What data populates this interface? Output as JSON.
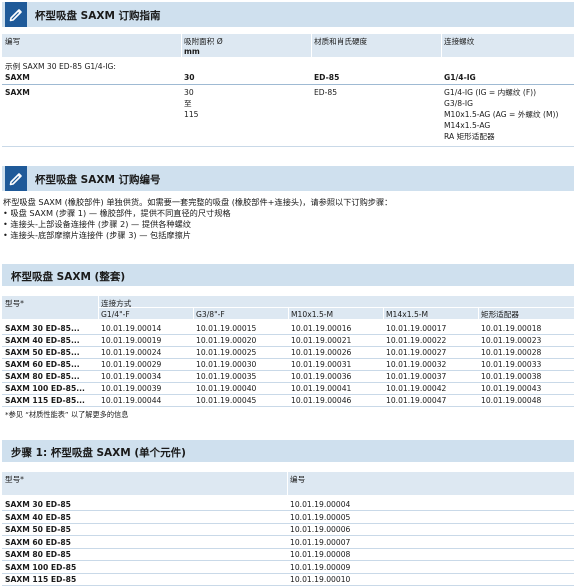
{
  "section1": {
    "title": "杯型吸盘 SAXM 订购指南",
    "headers": [
      "编写",
      "吸附面积 Ø\nmm",
      "材质和肖氏硬度",
      "连接螺纹"
    ],
    "header_col2_line1": "吸附面积 Ø",
    "header_col2_line2": "mm",
    "example_label": "示例 SAXM 30 ED-85 G1/4-IG:",
    "example_row": [
      "SAXM",
      "30",
      "ED-85",
      "G1/4-IG"
    ],
    "options_row": {
      "name": "SAXM",
      "sizes": [
        "30",
        "至",
        "115"
      ],
      "material": "ED-85",
      "threads": [
        "G1/4-IG (IG = 内螺纹 (F))",
        "G3/8-IG",
        "M10x1.5-AG (AG = 外螺纹 (M))",
        "M14x1.5-AG",
        "RA    矩形适配器"
      ]
    }
  },
  "section2": {
    "title": "杯型吸盘 SAXM 订购编号",
    "intro": "杯型吸盘 SAXM (橡胶部件) 单独供货。如需要一套完整的吸盘 (橡胶部件+连接头)，请参照以下订购步骤：",
    "bullets": [
      "• 吸盘 SAXM (步骤 1) — 橡胶部件，提供不同直径的尺寸规格",
      "• 连接头-上部设备连接件 (步骤 2) — 提供各种螺纹",
      "• 连接头-底部摩擦片连接件 (步骤 3) — 包括摩擦片"
    ]
  },
  "section3": {
    "title": "杯型吸盘 SAXM (整套)",
    "type_header": "型号*",
    "conn_header": "连接方式",
    "columns": [
      "G1/4\"-F",
      "G3/8\"-F",
      "M10x1.5-M",
      "M14x1.5-M",
      "矩形适配器"
    ],
    "rows": [
      {
        "type": "SAXM 30 ED-85...",
        "values": [
          "10.01.19.00014",
          "10.01.19.00015",
          "10.01.19.00016",
          "10.01.19.00017",
          "10.01.19.00018"
        ]
      },
      {
        "type": "SAXM 40 ED-85...",
        "values": [
          "10.01.19.00019",
          "10.01.19.00020",
          "10.01.19.00021",
          "10.01.19.00022",
          "10.01.19.00023"
        ]
      },
      {
        "type": "SAXM 50 ED-85...",
        "values": [
          "10.01.19.00024",
          "10.01.19.00025",
          "10.01.19.00026",
          "10.01.19.00027",
          "10.01.19.00028"
        ]
      },
      {
        "type": "SAXM 60 ED-85...",
        "values": [
          "10.01.19.00029",
          "10.01.19.00030",
          "10.01.19.00031",
          "10.01.19.00032",
          "10.01.19.00033"
        ]
      },
      {
        "type": "SAXM 80 ED-85...",
        "values": [
          "10.01.19.00034",
          "10.01.19.00035",
          "10.01.19.00036",
          "10.01.19.00037",
          "10.01.19.00038"
        ]
      },
      {
        "type": "SAXM 100 ED-85...",
        "values": [
          "10.01.19.00039",
          "10.01.19.00040",
          "10.01.19.00041",
          "10.01.19.00042",
          "10.01.19.00043"
        ]
      },
      {
        "type": "SAXM 115 ED-85...",
        "values": [
          "10.01.19.00044",
          "10.01.19.00045",
          "10.01.19.00046",
          "10.01.19.00047",
          "10.01.19.00048"
        ]
      }
    ],
    "footnote": "*参见 “材质性能表” 以了解更多的信息"
  },
  "section4": {
    "title": "步骤 1: 杯型吸盘 SAXM (单个元件)",
    "type_header": "型号*",
    "number_header": "编号",
    "rows": [
      {
        "type": "SAXM 30 ED-85",
        "number": "10.01.19.00004"
      },
      {
        "type": "SAXM 40 ED-85",
        "number": "10.01.19.00005"
      },
      {
        "type": "SAXM 50 ED-85",
        "number": "10.01.19.00006"
      },
      {
        "type": "SAXM 60 ED-85",
        "number": "10.01.19.00007"
      },
      {
        "type": "SAXM 80 ED-85",
        "number": "10.01.19.00008"
      },
      {
        "type": "SAXM 100 ED-85",
        "number": "10.01.19.00009"
      },
      {
        "type": "SAXM 115 ED-85",
        "number": "10.01.19.00010"
      }
    ]
  },
  "colors": {
    "band": "#cfe0ee",
    "header_row": "#dde8f2",
    "icon_bg": "#1f5a99"
  }
}
